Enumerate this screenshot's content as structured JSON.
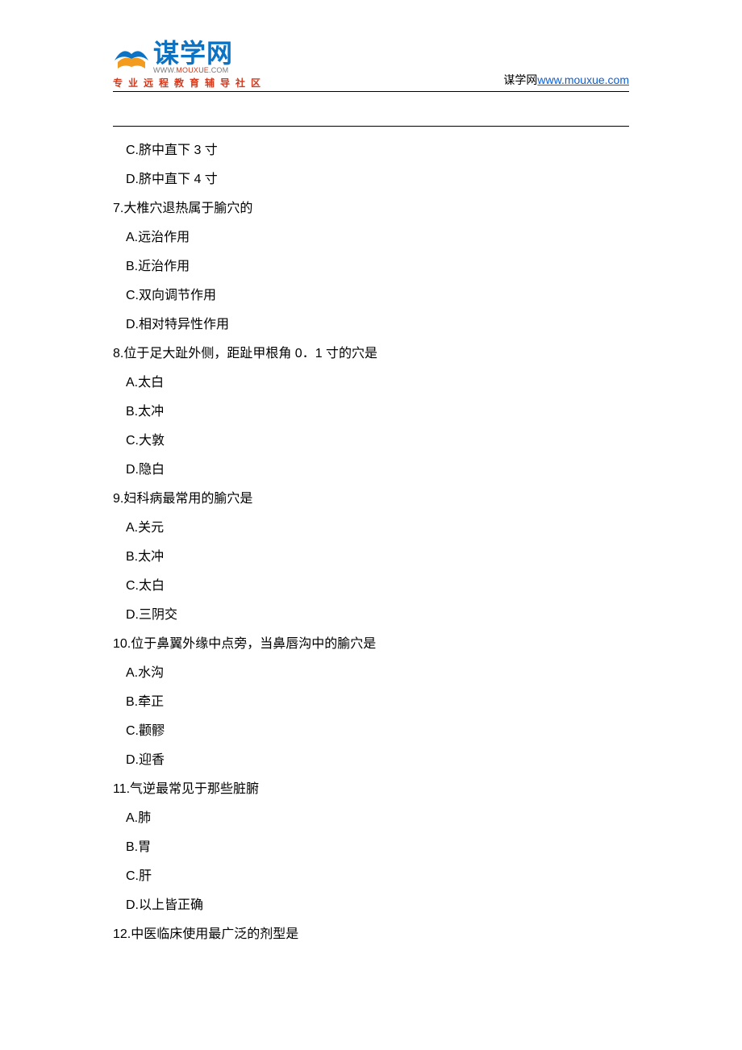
{
  "header": {
    "logo_cn": "谋学网",
    "logo_url_prefix": "WWW.",
    "logo_url_hot": "MOUXUE",
    "logo_url_suffix": ".COM",
    "tagline": "专业远程教育辅导社区",
    "right_prefix": "谋学网",
    "right_link": "www.mouxue.com"
  },
  "lines": [
    {
      "kind": "option",
      "text": "C.脐中直下 3 寸"
    },
    {
      "kind": "option",
      "text": "D.脐中直下 4 寸"
    },
    {
      "kind": "question",
      "text": "7.大椎穴退热属于腧穴的"
    },
    {
      "kind": "option",
      "text": "A.远治作用"
    },
    {
      "kind": "option",
      "text": "B.近治作用"
    },
    {
      "kind": "option",
      "text": "C.双向调节作用"
    },
    {
      "kind": "option",
      "text": "D.相对特异性作用"
    },
    {
      "kind": "question",
      "text": "8.位于足大趾外侧，距趾甲根角 0．1 寸的穴是"
    },
    {
      "kind": "option",
      "text": "A.太白"
    },
    {
      "kind": "option",
      "text": "B.太冲"
    },
    {
      "kind": "option",
      "text": "C.大敦"
    },
    {
      "kind": "option",
      "text": "D.隐白"
    },
    {
      "kind": "question",
      "text": "9.妇科病最常用的腧穴是"
    },
    {
      "kind": "option",
      "text": "A.关元"
    },
    {
      "kind": "option",
      "text": "B.太冲"
    },
    {
      "kind": "option",
      "text": "C.太白"
    },
    {
      "kind": "option",
      "text": "D.三阴交"
    },
    {
      "kind": "question",
      "text": "10.位于鼻翼外缘中点旁，当鼻唇沟中的腧穴是"
    },
    {
      "kind": "option",
      "text": "A.水沟"
    },
    {
      "kind": "option",
      "text": "B.牵正"
    },
    {
      "kind": "option",
      "text": "C.颧髎"
    },
    {
      "kind": "option",
      "text": "D.迎香"
    },
    {
      "kind": "question",
      "text": "11.气逆最常见于那些脏腑"
    },
    {
      "kind": "option",
      "text": "A.肺"
    },
    {
      "kind": "option",
      "text": "B.胃"
    },
    {
      "kind": "option",
      "text": "C.肝"
    },
    {
      "kind": "option",
      "text": "D.以上皆正确"
    },
    {
      "kind": "question",
      "text": "12.中医临床使用最广泛的剂型是"
    }
  ]
}
